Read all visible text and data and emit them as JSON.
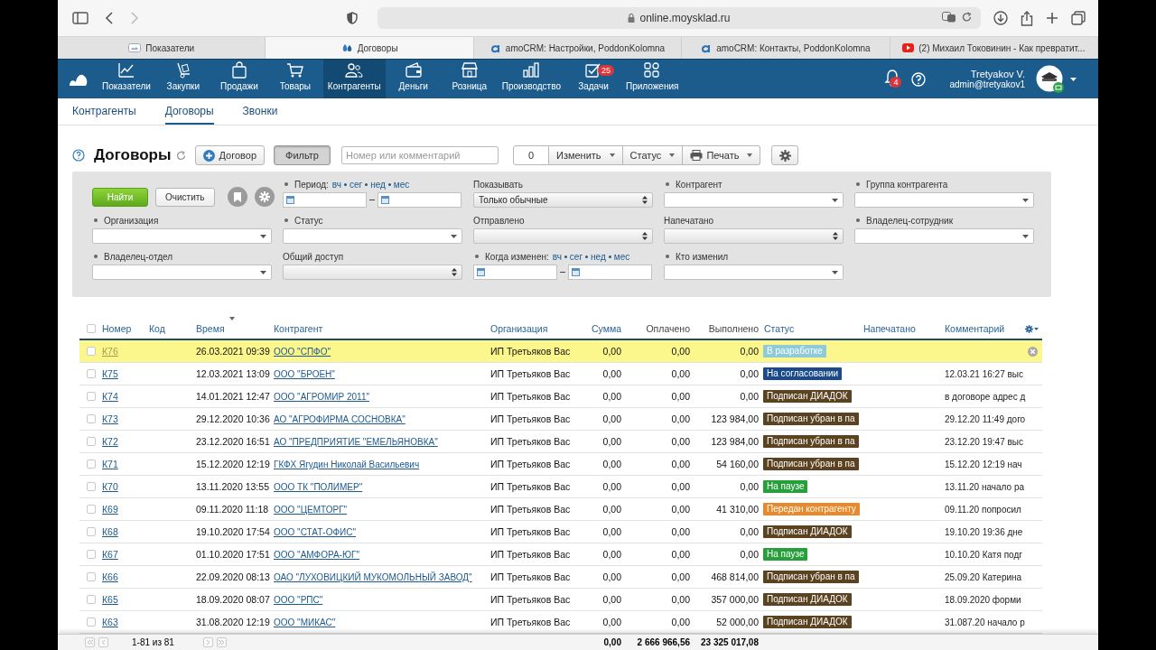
{
  "browser": {
    "url": "online.moysklad.ru",
    "forward_disabled": true,
    "tabs": [
      {
        "title": "Показатели",
        "selected": false
      },
      {
        "title": "Договоры",
        "selected": true
      },
      {
        "title": "amoCRM: Настройки, PoddonKolomna",
        "selected": false
      },
      {
        "title": "amoCRM: Контакты, PoddonKolomna",
        "selected": false
      },
      {
        "title": "(2) Михаил Токовинин - Как превратит...",
        "selected": false
      }
    ]
  },
  "nav": {
    "items": [
      {
        "label": "Показатели",
        "selected": false
      },
      {
        "label": "Закупки",
        "selected": false
      },
      {
        "label": "Продажи",
        "selected": false
      },
      {
        "label": "Товары",
        "selected": false
      },
      {
        "label": "Контрагенты",
        "selected": true
      },
      {
        "label": "Деньги",
        "selected": false
      },
      {
        "label": "Розница",
        "selected": false
      },
      {
        "label": "Производство",
        "selected": false
      },
      {
        "label": "Задачи",
        "selected": false,
        "badge": "25"
      },
      {
        "label": "Приложения",
        "selected": false
      }
    ],
    "notifications": "4",
    "user_name": "Tretyakov V.",
    "user_login": "admin@tretyakov1"
  },
  "subnav": [
    {
      "label": "Контрагенты",
      "selected": false
    },
    {
      "label": "Договоры",
      "selected": true
    },
    {
      "label": "Звонки",
      "selected": false
    }
  ],
  "toolbar": {
    "title": "Договоры",
    "new_button": "Договор",
    "filter_button": "Фильтр",
    "filter_active": true,
    "search_placeholder": "Номер или комментарий",
    "selected_count": "0",
    "change_menu": "Изменить",
    "status_menu": "Статус",
    "print_menu": "Печать"
  },
  "filters": {
    "find_button": "Найти",
    "clear_button": "Очистить",
    "fields": [
      {
        "kind": "date-range",
        "label": "Период:",
        "marked": true,
        "quick": [
          "вч",
          "сег",
          "нед",
          "мес"
        ]
      },
      {
        "kind": "combo",
        "label": "Показывать",
        "marked": false,
        "value": "Только обычные"
      },
      {
        "kind": "select",
        "label": "Контрагент",
        "marked": true
      },
      {
        "kind": "select",
        "label": "Группа контрагента",
        "marked": true
      },
      {
        "kind": "select",
        "label": "Организация",
        "marked": true
      },
      {
        "kind": "select",
        "label": "Статус",
        "marked": true
      },
      {
        "kind": "combo",
        "label": "Отправлено",
        "marked": false
      },
      {
        "kind": "combo",
        "label": "Напечатано",
        "marked": false
      },
      {
        "kind": "select",
        "label": "Владелец-сотрудник",
        "marked": true
      },
      {
        "kind": "select",
        "label": "Владелец-отдел",
        "marked": true
      },
      {
        "kind": "combo",
        "label": "Общий доступ",
        "marked": false
      },
      {
        "kind": "date-range",
        "label": "Когда изменен:",
        "marked": true,
        "quick": [
          "вч",
          "сег",
          "нед",
          "мес"
        ]
      },
      {
        "kind": "select",
        "label": "Кто изменил",
        "marked": true
      }
    ]
  },
  "table": {
    "all_checked": false,
    "columns": [
      {
        "label": "Номер",
        "sortable": true,
        "sorted": false
      },
      {
        "label": "Код",
        "sortable": true,
        "sorted": false
      },
      {
        "label": "Время",
        "sortable": true,
        "sorted": true
      },
      {
        "label": "Контрагент",
        "sortable": true,
        "sorted": false
      },
      {
        "label": "Организация",
        "sortable": true,
        "sorted": false
      },
      {
        "label": "Сумма",
        "sortable": true,
        "sorted": false
      },
      {
        "label": "Оплачено",
        "sortable": false,
        "sorted": false
      },
      {
        "label": "Выполнено",
        "sortable": false,
        "sorted": false
      },
      {
        "label": "Статус",
        "sortable": true,
        "sorted": false
      },
      {
        "label": "Напечатано",
        "sortable": true,
        "sorted": false
      },
      {
        "label": "Комментарий",
        "sortable": true,
        "sorted": false
      }
    ],
    "rows": [
      {
        "number": "К76",
        "time": "26.03.2021 09:39",
        "contractor": "ООО \"СПФО\"",
        "organization": "ИП Третьяков Вас",
        "sum": "0,00",
        "paid": "0,00",
        "done": "0,00",
        "status": {
          "label": "В разработке",
          "color": "#8fcad8"
        },
        "comment": "",
        "selected": true,
        "checked": false
      },
      {
        "number": "К75",
        "time": "12.03.2021 13:09",
        "contractor": "ООО \"БРОЕН\"",
        "organization": "ИП Третьяков Вас",
        "sum": "0,00",
        "paid": "0,00",
        "done": "0,00",
        "status": {
          "label": "На согласовании",
          "color": "#1b4a8a"
        },
        "comment": "12.03.21 16:27 выс",
        "selected": false,
        "checked": false
      },
      {
        "number": "К74",
        "time": "14.01.2021 12:47",
        "contractor": "ООО \"АГРОМИР 2011\"",
        "organization": "ИП Третьяков Вас",
        "sum": "0,00",
        "paid": "0,00",
        "done": "0,00",
        "status": {
          "label": "Подписан ДИАДОК",
          "color": "#5b4220"
        },
        "comment": "в договоре адрес д",
        "selected": false,
        "checked": false
      },
      {
        "number": "К73",
        "time": "29.12.2020 10:36",
        "contractor": "АО \"АГРОФИРМА СОСНОВКА\"",
        "organization": "ИП Третьяков Вас",
        "sum": "0,00",
        "paid": "0,00",
        "done": "123 984,00",
        "status": {
          "label": "Подписан убран в па",
          "color": "#5b4220"
        },
        "comment": "29.12.20 11:49 дого",
        "selected": false,
        "checked": false
      },
      {
        "number": "К72",
        "time": "23.12.2020 16:51",
        "contractor": "АО \"ПРЕДПРИЯТИЕ \"ЕМЕЛЬЯНОВКА\"",
        "organization": "ИП Третьяков Вас",
        "sum": "0,00",
        "paid": "0,00",
        "done": "123 984,00",
        "status": {
          "label": "Подписан убран в па",
          "color": "#5b4220"
        },
        "comment": "23.12.20 19:47 выс",
        "selected": false,
        "checked": false
      },
      {
        "number": "К71",
        "time": "15.12.2020 12:19",
        "contractor": "ГКФХ Ягудин Николай Васильевич",
        "organization": "ИП Третьяков Вас",
        "sum": "0,00",
        "paid": "0,00",
        "done": "54 160,00",
        "status": {
          "label": "Подписан убран в па",
          "color": "#5b4220"
        },
        "comment": "15.12.20 12:19 нач",
        "selected": false,
        "checked": false
      },
      {
        "number": "К70",
        "time": "13.11.2020 13:55",
        "contractor": "ООО ТК \"ПОЛИМЕР\"",
        "organization": "ИП Третьяков Вас",
        "sum": "0,00",
        "paid": "0,00",
        "done": "0,00",
        "status": {
          "label": "На паузе",
          "color": "#27a03c"
        },
        "comment": "13.11.20 начало ра",
        "selected": false,
        "checked": false
      },
      {
        "number": "К69",
        "time": "09.11.2020 11:18",
        "contractor": "ООО \"ЦЕМТОРГ\"",
        "organization": "ИП Третьяков Вас",
        "sum": "0,00",
        "paid": "0,00",
        "done": "41 310,00",
        "status": {
          "label": "Передан контрагенту",
          "color": "#e8892c"
        },
        "comment": "09.11.20 попросил",
        "selected": false,
        "checked": false
      },
      {
        "number": "К68",
        "time": "19.10.2020 17:54",
        "contractor": "ООО \"СТАТ-ОФИС\"",
        "organization": "ИП Третьяков Вас",
        "sum": "0,00",
        "paid": "0,00",
        "done": "0,00",
        "status": {
          "label": "Подписан ДИАДОК",
          "color": "#5b4220"
        },
        "comment": "19.10.20 19:36 дне",
        "selected": false,
        "checked": false
      },
      {
        "number": "К67",
        "time": "01.10.2020 17:51",
        "contractor": "ООО \"АМФОРА-ЮГ\"",
        "organization": "ИП Третьяков Вас",
        "sum": "0,00",
        "paid": "0,00",
        "done": "0,00",
        "status": {
          "label": "На паузе",
          "color": "#27a03c"
        },
        "comment": "10.10.20 Катя подг",
        "selected": false,
        "checked": false
      },
      {
        "number": "К66",
        "time": "22.09.2020 08:13",
        "contractor": "ОАО \"ЛУХОВИЦКИЙ МУКОМОЛЬНЫЙ ЗАВОД\"",
        "organization": "ИП Третьяков Вас",
        "sum": "0,00",
        "paid": "0,00",
        "done": "468 814,00",
        "status": {
          "label": "Подписан убран в па",
          "color": "#5b4220"
        },
        "comment": "25.09.20 Катерина",
        "selected": false,
        "checked": false
      },
      {
        "number": "К65",
        "time": "18.09.2020 08:07",
        "contractor": "ООО \"РПС\"",
        "organization": "ИП Третьяков Вас",
        "sum": "0,00",
        "paid": "0,00",
        "done": "357 000,00",
        "status": {
          "label": "Подписан ДИАДОК",
          "color": "#5b4220"
        },
        "comment": "18.09.2020 форми",
        "selected": false,
        "checked": false
      },
      {
        "number": "К63",
        "time": "31.08.2020 12:19",
        "contractor": "ООО \"МИКАС\"",
        "organization": "ИП Третьяков Вас",
        "sum": "0,00",
        "paid": "0,00",
        "done": "52 000,00",
        "status": {
          "label": "Подписан ДИАДОК",
          "color": "#5b4220"
        },
        "comment": "31.087.20 начало р",
        "selected": false,
        "checked": false
      }
    ]
  },
  "footer": {
    "range": "1-81 из 81",
    "total_sum": "0,00",
    "total_paid": "2 666 966,56",
    "total_done": "23 325 017,08"
  }
}
